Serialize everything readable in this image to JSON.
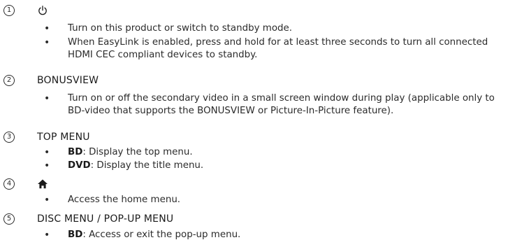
{
  "items": [
    {
      "number": "1",
      "icon": "power-icon",
      "bullets": [
        {
          "text": "Turn on this product or switch to standby mode."
        },
        {
          "text": "When EasyLink is enabled, press and hold for at least three seconds to turn all connected HDMI CEC compliant devices to standby."
        }
      ]
    },
    {
      "number": "2",
      "heading": "BONUSVIEW",
      "bullets": [
        {
          "text": "Turn on or off the secondary video in a small screen window during play (applicable only to BD-video that supports the BONUSVIEW or Picture-In-Picture feature)."
        }
      ]
    },
    {
      "number": "3",
      "heading": "TOP MENU",
      "bullets": [
        {
          "term": "BD",
          "text": ": Display the top menu."
        },
        {
          "term": "DVD",
          "text": ": Display the title menu."
        }
      ]
    },
    {
      "number": "4",
      "icon": "home-icon",
      "bullets": [
        {
          "text": "Access the home menu."
        }
      ]
    },
    {
      "number": "5",
      "heading": "DISC MENU / POP-UP MENU",
      "bullets": [
        {
          "term": "BD",
          "text": ": Access or exit the pop-up menu."
        }
      ]
    }
  ],
  "bullet_char": "•"
}
